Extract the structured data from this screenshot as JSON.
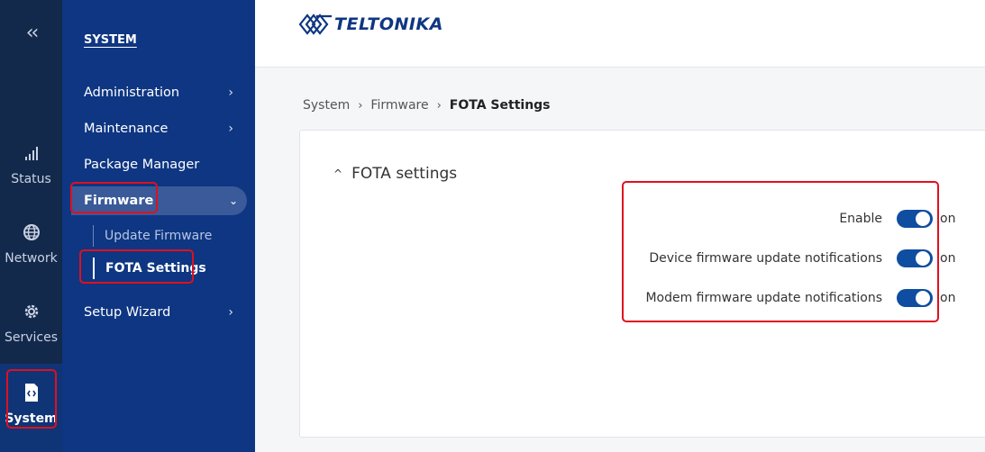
{
  "rail": {
    "collapse_icon": "double-chevron-left-icon",
    "items": [
      {
        "label": "Status",
        "icon": "signal-bars-icon"
      },
      {
        "label": "Network",
        "icon": "globe-icon"
      },
      {
        "label": "Services",
        "icon": "gear-icon"
      },
      {
        "label": "System",
        "icon": "file-code-icon",
        "active": true
      }
    ]
  },
  "submenu": {
    "title": "SYSTEM",
    "items": [
      {
        "label": "Administration",
        "chevron": "›"
      },
      {
        "label": "Maintenance",
        "chevron": "›"
      },
      {
        "label": "Package Manager"
      },
      {
        "label": "Firmware",
        "chevron": "⌄",
        "open": true
      },
      {
        "label": "Setup Wizard",
        "chevron": "›"
      }
    ],
    "firmware_children": [
      {
        "label": "Update Firmware"
      },
      {
        "label": "FOTA Settings",
        "active": true
      }
    ]
  },
  "header": {
    "logo_text": "TELTONIKA"
  },
  "breadcrumb": {
    "items": [
      "System",
      "Firmware",
      "FOTA Settings"
    ],
    "separator": "›"
  },
  "section": {
    "title": "FOTA settings",
    "caret": "^",
    "rows": [
      {
        "label": "Enable",
        "state": "on"
      },
      {
        "label": "Device firmware update notifications",
        "state": "on"
      },
      {
        "label": "Modem firmware update notifications",
        "state": "on"
      }
    ]
  },
  "colors": {
    "rail_bg": "#13294b",
    "submenu_bg": "#0e3682",
    "toggle_on": "#0e4da0",
    "highlight": "#e0101e"
  }
}
